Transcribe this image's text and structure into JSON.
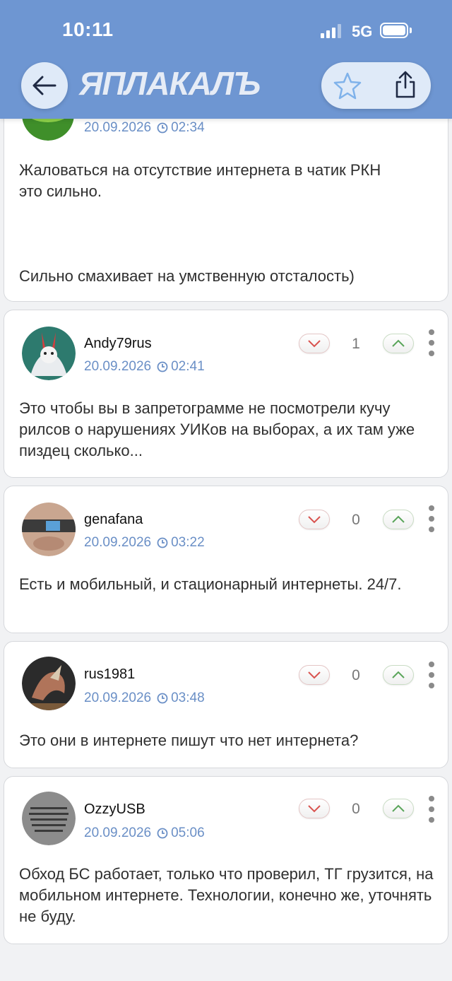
{
  "status_bar": {
    "time": "10:11",
    "network": "5G"
  },
  "header": {
    "logo": "ЯПЛАКАЛЪ"
  },
  "comments": [
    {
      "username": "",
      "date": "20.09.2026",
      "time": "02:34",
      "text": "Жаловаться на отсутствие интернета в чатик РКН это сильно.\n\n\nСильно смахивает на умственную отсталость)"
    },
    {
      "username": "Andy79rus",
      "date": "20.09.2026",
      "time": "02:41",
      "rating": "1",
      "text": "Это чтобы вы в запретограмме не посмотрели кучу рилсов о нарушениях УИКов на выборах, а их там уже пиздец сколько..."
    },
    {
      "username": "genafana",
      "date": "20.09.2026",
      "time": "03:22",
      "rating": "0",
      "text": "Есть и мобильный, и стационарный интернеты. 24/7."
    },
    {
      "username": "rus1981",
      "date": "20.09.2026",
      "time": "03:48",
      "rating": "0",
      "text": "Это они в интернете пишут что нет интернета?"
    },
    {
      "username": "OzzyUSB",
      "date": "20.09.2026",
      "time": "05:06",
      "rating": "0",
      "text": "Обход БС работает, только что проверил, ТГ грузится, на мобильном интернете. Технологии, конечно же, уточнять не буду."
    }
  ],
  "colors": {
    "header": "#6e96d2",
    "meta": "#6a8fc6",
    "downvote": "#d9534f",
    "upvote": "#5aa55a"
  }
}
